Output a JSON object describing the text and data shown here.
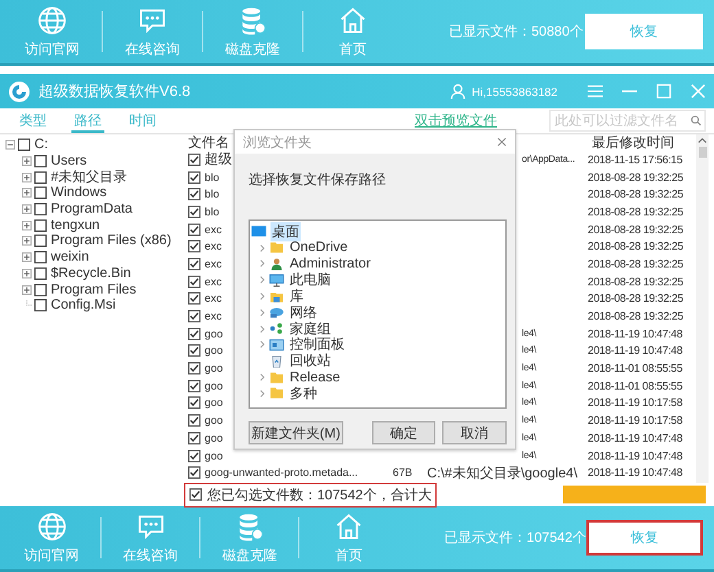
{
  "top_bar": {
    "nav": [
      {
        "kind": "globe",
        "label": "访问官网"
      },
      {
        "kind": "chat",
        "label": "在线咨询"
      },
      {
        "kind": "database",
        "label": "磁盘克隆"
      },
      {
        "kind": "home",
        "label": "首页"
      }
    ],
    "file_count": "已显示文件：50880个",
    "recover_button": {
      "label": "恢复",
      "highlighted": false
    }
  },
  "window": {
    "title": "超级数据恢复软件V6.8",
    "user": "Hi,15553863182"
  },
  "tabs": [
    {
      "label": "类型",
      "selected": false
    },
    {
      "label": "路径",
      "selected": true
    },
    {
      "label": "时间",
      "selected": false
    }
  ],
  "preview_link": "双击预览文件",
  "filter": {
    "placeholder": "此处可以过滤文件名"
  },
  "tree": {
    "label": "C:",
    "expanded": true,
    "checked": false,
    "children": [
      {
        "label": "Users",
        "expandable": true,
        "checked": false
      },
      {
        "label": "#未知父目录",
        "expandable": true,
        "checked": false
      },
      {
        "label": "Windows",
        "expandable": true,
        "checked": false
      },
      {
        "label": "ProgramData",
        "expandable": true,
        "checked": false
      },
      {
        "label": "tengxun",
        "expandable": true,
        "checked": false
      },
      {
        "label": "Program Files (x86)",
        "expandable": true,
        "checked": false
      },
      {
        "label": "weixin",
        "expandable": true,
        "checked": false
      },
      {
        "label": "$Recycle.Bin",
        "expandable": true,
        "checked": false
      },
      {
        "label": "Program Files",
        "expandable": true,
        "checked": false
      },
      {
        "label": "Config.Msi",
        "expandable": false,
        "checked": false
      }
    ]
  },
  "table": {
    "name_header": "文件名",
    "date_header": "最后修改时间",
    "rows": [
      {
        "kind": "partial",
        "checked": true,
        "name": "超级",
        "path": "or\\AppData...",
        "date": "2018-11-15 17:56:15"
      },
      {
        "kind": "partial",
        "checked": true,
        "name": "blo",
        "date": "2018-08-28 19:32:25"
      },
      {
        "kind": "partial",
        "checked": true,
        "name": "blo",
        "date": "2018-08-28 19:32:25"
      },
      {
        "kind": "partial",
        "checked": true,
        "name": "blo",
        "date": "2018-08-28 19:32:25"
      },
      {
        "kind": "partial",
        "checked": true,
        "name": "exc",
        "date": "2018-08-28 19:32:25"
      },
      {
        "kind": "partial",
        "checked": true,
        "name": "exc",
        "date": "2018-08-28 19:32:25"
      },
      {
        "kind": "partial",
        "checked": true,
        "name": "exc",
        "date": "2018-08-28 19:32:25"
      },
      {
        "kind": "partial",
        "checked": true,
        "name": "exc",
        "date": "2018-08-28 19:32:25"
      },
      {
        "kind": "partial",
        "checked": true,
        "name": "exc",
        "date": "2018-08-28 19:32:25"
      },
      {
        "kind": "partial",
        "checked": true,
        "name": "exc",
        "date": "2018-08-28 19:32:25"
      },
      {
        "kind": "partial",
        "checked": true,
        "name": "goo",
        "path": "le4\\",
        "date": "2018-11-19 10:47:48"
      },
      {
        "kind": "partial",
        "checked": true,
        "name": "goo",
        "path": "le4\\",
        "date": "2018-11-19 10:47:48"
      },
      {
        "kind": "partial",
        "checked": true,
        "name": "goo",
        "path": "le4\\",
        "date": "2018-11-01 08:55:55"
      },
      {
        "kind": "partial",
        "checked": true,
        "name": "goo",
        "path": "le4\\",
        "date": "2018-11-01 08:55:55"
      },
      {
        "kind": "partial",
        "checked": true,
        "name": "goo",
        "path": "le4\\",
        "date": "2018-11-19 10:17:58"
      },
      {
        "kind": "partial",
        "checked": true,
        "name": "goo",
        "path": "le4\\",
        "date": "2018-11-19 10:17:58"
      },
      {
        "kind": "partial",
        "checked": true,
        "name": "goo",
        "path": "le4\\",
        "date": "2018-11-19 10:47:48"
      },
      {
        "kind": "partial",
        "checked": true,
        "name": "goo",
        "path": "le4\\",
        "date": "2018-11-19 10:47:48"
      },
      {
        "kind": "full",
        "checked": true,
        "name": "goog-unwanted-proto.metada...",
        "size": "67B",
        "path": "C:\\#未知父目录\\google4\\",
        "date": "2018-11-19 10:47:48"
      }
    ]
  },
  "dialog": {
    "title": "浏览文件夹",
    "prompt": "选择恢复文件保存路径",
    "folders": [
      {
        "kind": "desktop",
        "label": "桌面",
        "expandable": false,
        "selected": true
      },
      {
        "kind": "folder",
        "label": "OneDrive",
        "expandable": true,
        "selected": false
      },
      {
        "kind": "user",
        "label": "Administrator",
        "expandable": true,
        "selected": false
      },
      {
        "kind": "computer",
        "label": "此电脑",
        "expandable": true,
        "selected": false
      },
      {
        "kind": "library",
        "label": "库",
        "expandable": true,
        "selected": false
      },
      {
        "kind": "network",
        "label": "网络",
        "expandable": true,
        "selected": false
      },
      {
        "kind": "homegroup",
        "label": "家庭组",
        "expandable": true,
        "selected": false
      },
      {
        "kind": "control-panel",
        "label": "控制面板",
        "expandable": true,
        "selected": false
      },
      {
        "kind": "recycle-bin",
        "label": "回收站",
        "expandable": false,
        "selected": false
      },
      {
        "kind": "folder",
        "label": "Release",
        "expandable": true,
        "selected": false
      },
      {
        "kind": "folder",
        "label": "多种",
        "expandable": true,
        "selected": false
      }
    ],
    "buttons": [
      "新建文件夹(M)",
      "确定",
      "取消"
    ]
  },
  "status": {
    "checked": true,
    "text": "您已勾选文件数：107542个，合计大",
    "highlighted": true
  },
  "bottom_bar": {
    "nav": [
      {
        "kind": "globe",
        "label": "访问官网"
      },
      {
        "kind": "chat",
        "label": "在线咨询"
      },
      {
        "kind": "database",
        "label": "磁盘克隆"
      },
      {
        "kind": "home",
        "label": "首页"
      }
    ],
    "file_count": "已显示文件：107542个",
    "recover_button": {
      "label": "恢复",
      "highlighted": true
    }
  }
}
